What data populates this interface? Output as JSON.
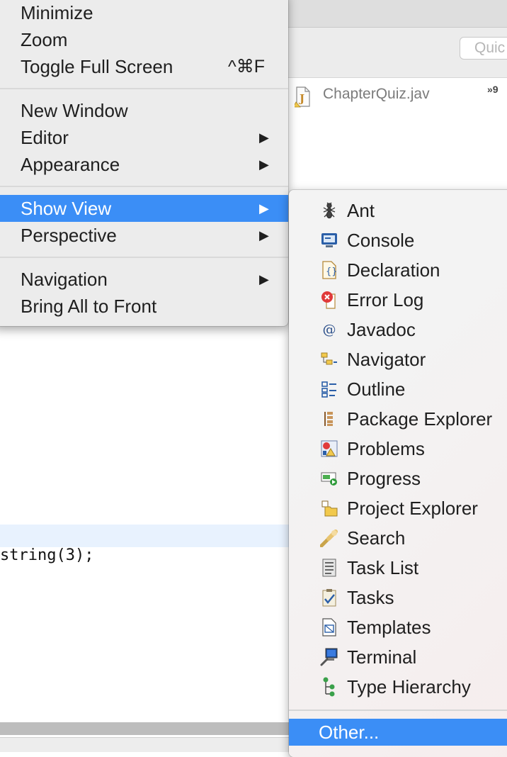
{
  "quick_access": {
    "text": "Quic"
  },
  "editor": {
    "tab_label": "ChapterQuiz.jav",
    "tab_overflow": "»9",
    "code_line": "string(3);"
  },
  "window_menu": {
    "items": [
      {
        "label": "Minimize"
      },
      {
        "label": "Zoom"
      },
      {
        "label": "Toggle Full Screen",
        "shortcut": "^⌘F"
      },
      {
        "label": "New Window"
      },
      {
        "label": "Editor",
        "arrow": "▶"
      },
      {
        "label": "Appearance",
        "arrow": "▶"
      },
      {
        "label": "Show View",
        "arrow": "▶"
      },
      {
        "label": "Perspective",
        "arrow": "▶"
      },
      {
        "label": "Navigation",
        "arrow": "▶"
      },
      {
        "label": "Bring All to Front"
      }
    ],
    "active_item": "Show View"
  },
  "show_view_menu": {
    "items": [
      {
        "label": "Ant",
        "icon": "ant-icon"
      },
      {
        "label": "Console",
        "icon": "console-icon"
      },
      {
        "label": "Declaration",
        "icon": "declaration-icon"
      },
      {
        "label": "Error Log",
        "icon": "error-log-icon"
      },
      {
        "label": "Javadoc",
        "icon": "javadoc-icon"
      },
      {
        "label": "Navigator",
        "icon": "navigator-icon"
      },
      {
        "label": "Outline",
        "icon": "outline-icon"
      },
      {
        "label": "Package Explorer",
        "icon": "package-explorer-icon"
      },
      {
        "label": "Problems",
        "icon": "problems-icon"
      },
      {
        "label": "Progress",
        "icon": "progress-icon"
      },
      {
        "label": "Project Explorer",
        "icon": "project-explorer-icon"
      },
      {
        "label": "Search",
        "icon": "search-icon"
      },
      {
        "label": "Task List",
        "icon": "task-list-icon"
      },
      {
        "label": "Tasks",
        "icon": "tasks-icon"
      },
      {
        "label": "Templates",
        "icon": "templates-icon"
      },
      {
        "label": "Terminal",
        "icon": "terminal-icon"
      },
      {
        "label": "Type Hierarchy",
        "icon": "type-hierarchy-icon"
      }
    ],
    "other_label": "Other...",
    "highlighted_item": "Other..."
  },
  "colors": {
    "menu_highlight": "#3b8ef6",
    "menu_background": "#ececec",
    "current_line_highlight": "#e8f2fe"
  }
}
